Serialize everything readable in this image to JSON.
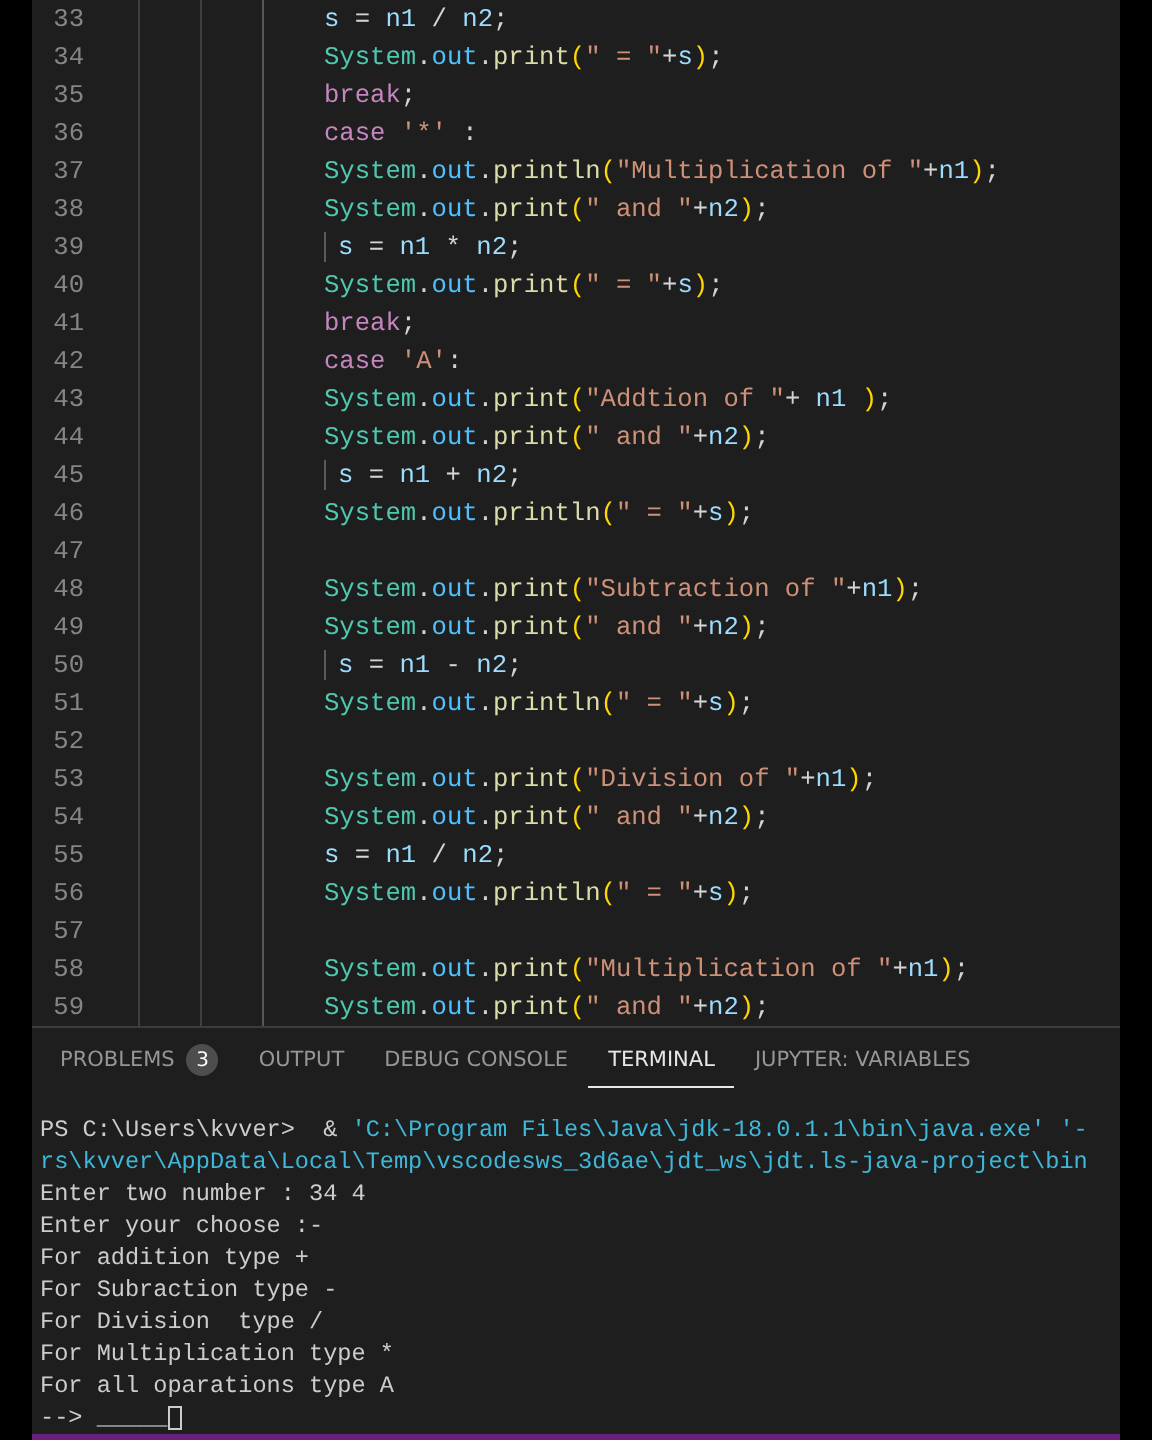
{
  "editor": {
    "lines": [
      {
        "number": "33",
        "tokens": [
          {
            "kind": "var",
            "text": "s"
          },
          {
            "kind": "op",
            "text": " = "
          },
          {
            "kind": "var",
            "text": "n1"
          },
          {
            "kind": "op",
            "text": " / "
          },
          {
            "kind": "var",
            "text": "n2"
          },
          {
            "kind": "op",
            "text": ";"
          }
        ]
      },
      {
        "number": "34",
        "tokens": [
          {
            "kind": "class",
            "text": "System"
          },
          {
            "kind": "op",
            "text": "."
          },
          {
            "kind": "field",
            "text": "out"
          },
          {
            "kind": "op",
            "text": "."
          },
          {
            "kind": "method",
            "text": "print"
          },
          {
            "kind": "paren",
            "text": "("
          },
          {
            "kind": "string",
            "text": "\" = \""
          },
          {
            "kind": "op",
            "text": "+"
          },
          {
            "kind": "var",
            "text": "s"
          },
          {
            "kind": "paren",
            "text": ")"
          },
          {
            "kind": "op",
            "text": ";"
          }
        ]
      },
      {
        "number": "35",
        "tokens": [
          {
            "kind": "keyword",
            "text": "break"
          },
          {
            "kind": "op",
            "text": ";"
          }
        ]
      },
      {
        "number": "36",
        "tokens": [
          {
            "kind": "keyword",
            "text": "case "
          },
          {
            "kind": "string",
            "text": "'*'"
          },
          {
            "kind": "op",
            "text": " :"
          }
        ]
      },
      {
        "number": "37",
        "tokens": [
          {
            "kind": "class",
            "text": "System"
          },
          {
            "kind": "op",
            "text": "."
          },
          {
            "kind": "field",
            "text": "out"
          },
          {
            "kind": "op",
            "text": "."
          },
          {
            "kind": "method",
            "text": "println"
          },
          {
            "kind": "paren",
            "text": "("
          },
          {
            "kind": "string",
            "text": "\"Multiplication of \""
          },
          {
            "kind": "op",
            "text": "+"
          },
          {
            "kind": "var",
            "text": "n1"
          },
          {
            "kind": "paren",
            "text": ")"
          },
          {
            "kind": "op",
            "text": ";"
          }
        ]
      },
      {
        "number": "38",
        "tokens": [
          {
            "kind": "class",
            "text": "System"
          },
          {
            "kind": "op",
            "text": "."
          },
          {
            "kind": "field",
            "text": "out"
          },
          {
            "kind": "op",
            "text": "."
          },
          {
            "kind": "method",
            "text": "print"
          },
          {
            "kind": "paren",
            "text": "("
          },
          {
            "kind": "string",
            "text": "\" and \""
          },
          {
            "kind": "op",
            "text": "+"
          },
          {
            "kind": "var",
            "text": "n2"
          },
          {
            "kind": "paren",
            "text": ")"
          },
          {
            "kind": "op",
            "text": ";"
          }
        ]
      },
      {
        "number": "39",
        "bar": true,
        "tokens": [
          {
            "kind": "var",
            "text": "s"
          },
          {
            "kind": "op",
            "text": " = "
          },
          {
            "kind": "var",
            "text": "n1"
          },
          {
            "kind": "op",
            "text": " * "
          },
          {
            "kind": "var",
            "text": "n2"
          },
          {
            "kind": "op",
            "text": ";"
          }
        ]
      },
      {
        "number": "40",
        "tokens": [
          {
            "kind": "class",
            "text": "System"
          },
          {
            "kind": "op",
            "text": "."
          },
          {
            "kind": "field",
            "text": "out"
          },
          {
            "kind": "op",
            "text": "."
          },
          {
            "kind": "method",
            "text": "print"
          },
          {
            "kind": "paren",
            "text": "("
          },
          {
            "kind": "string",
            "text": "\" = \""
          },
          {
            "kind": "op",
            "text": "+"
          },
          {
            "kind": "var",
            "text": "s"
          },
          {
            "kind": "paren",
            "text": ")"
          },
          {
            "kind": "op",
            "text": ";"
          }
        ]
      },
      {
        "number": "41",
        "tokens": [
          {
            "kind": "keyword",
            "text": "break"
          },
          {
            "kind": "op",
            "text": ";"
          }
        ]
      },
      {
        "number": "42",
        "tokens": [
          {
            "kind": "keyword",
            "text": "case "
          },
          {
            "kind": "string",
            "text": "'A'"
          },
          {
            "kind": "op",
            "text": ":"
          }
        ]
      },
      {
        "number": "43",
        "tokens": [
          {
            "kind": "class",
            "text": "System"
          },
          {
            "kind": "op",
            "text": "."
          },
          {
            "kind": "field",
            "text": "out"
          },
          {
            "kind": "op",
            "text": "."
          },
          {
            "kind": "method",
            "text": "print"
          },
          {
            "kind": "paren",
            "text": "("
          },
          {
            "kind": "string",
            "text": "\"Addtion of \""
          },
          {
            "kind": "op",
            "text": "+ "
          },
          {
            "kind": "var",
            "text": "n1 "
          },
          {
            "kind": "paren",
            "text": ")"
          },
          {
            "kind": "op",
            "text": ";"
          }
        ]
      },
      {
        "number": "44",
        "tokens": [
          {
            "kind": "class",
            "text": "System"
          },
          {
            "kind": "op",
            "text": "."
          },
          {
            "kind": "field",
            "text": "out"
          },
          {
            "kind": "op",
            "text": "."
          },
          {
            "kind": "method",
            "text": "print"
          },
          {
            "kind": "paren",
            "text": "("
          },
          {
            "kind": "string",
            "text": "\" and \""
          },
          {
            "kind": "op",
            "text": "+"
          },
          {
            "kind": "var",
            "text": "n2"
          },
          {
            "kind": "paren",
            "text": ")"
          },
          {
            "kind": "op",
            "text": ";"
          }
        ]
      },
      {
        "number": "45",
        "bar": true,
        "tokens": [
          {
            "kind": "var",
            "text": "s"
          },
          {
            "kind": "op",
            "text": " = "
          },
          {
            "kind": "var",
            "text": "n1"
          },
          {
            "kind": "op",
            "text": " + "
          },
          {
            "kind": "var",
            "text": "n2"
          },
          {
            "kind": "op",
            "text": ";"
          }
        ]
      },
      {
        "number": "46",
        "tokens": [
          {
            "kind": "class",
            "text": "System"
          },
          {
            "kind": "op",
            "text": "."
          },
          {
            "kind": "field",
            "text": "out"
          },
          {
            "kind": "op",
            "text": "."
          },
          {
            "kind": "method",
            "text": "println"
          },
          {
            "kind": "paren",
            "text": "("
          },
          {
            "kind": "string",
            "text": "\" = \""
          },
          {
            "kind": "op",
            "text": "+"
          },
          {
            "kind": "var",
            "text": "s"
          },
          {
            "kind": "paren",
            "text": ")"
          },
          {
            "kind": "op",
            "text": ";"
          }
        ]
      },
      {
        "number": "47"
      },
      {
        "number": "48",
        "tokens": [
          {
            "kind": "class",
            "text": "System"
          },
          {
            "kind": "op",
            "text": "."
          },
          {
            "kind": "field",
            "text": "out"
          },
          {
            "kind": "op",
            "text": "."
          },
          {
            "kind": "method",
            "text": "print"
          },
          {
            "kind": "paren",
            "text": "("
          },
          {
            "kind": "string",
            "text": "\"Subtraction of \""
          },
          {
            "kind": "op",
            "text": "+"
          },
          {
            "kind": "var",
            "text": "n1"
          },
          {
            "kind": "paren",
            "text": ")"
          },
          {
            "kind": "op",
            "text": ";"
          }
        ]
      },
      {
        "number": "49",
        "tokens": [
          {
            "kind": "class",
            "text": "System"
          },
          {
            "kind": "op",
            "text": "."
          },
          {
            "kind": "field",
            "text": "out"
          },
          {
            "kind": "op",
            "text": "."
          },
          {
            "kind": "method",
            "text": "print"
          },
          {
            "kind": "paren",
            "text": "("
          },
          {
            "kind": "string",
            "text": "\" and \""
          },
          {
            "kind": "op",
            "text": "+"
          },
          {
            "kind": "var",
            "text": "n2"
          },
          {
            "kind": "paren",
            "text": ")"
          },
          {
            "kind": "op",
            "text": ";"
          }
        ]
      },
      {
        "number": "50",
        "bar": true,
        "tokens": [
          {
            "kind": "var",
            "text": "s"
          },
          {
            "kind": "op",
            "text": " = "
          },
          {
            "kind": "var",
            "text": "n1"
          },
          {
            "kind": "op",
            "text": " - "
          },
          {
            "kind": "var",
            "text": "n2"
          },
          {
            "kind": "op",
            "text": ";"
          }
        ]
      },
      {
        "number": "51",
        "tokens": [
          {
            "kind": "class",
            "text": "System"
          },
          {
            "kind": "op",
            "text": "."
          },
          {
            "kind": "field",
            "text": "out"
          },
          {
            "kind": "op",
            "text": "."
          },
          {
            "kind": "method",
            "text": "println"
          },
          {
            "kind": "paren",
            "text": "("
          },
          {
            "kind": "string",
            "text": "\" = \""
          },
          {
            "kind": "op",
            "text": "+"
          },
          {
            "kind": "var",
            "text": "s"
          },
          {
            "kind": "paren",
            "text": ")"
          },
          {
            "kind": "op",
            "text": ";"
          }
        ]
      },
      {
        "number": "52"
      },
      {
        "number": "53",
        "tokens": [
          {
            "kind": "class",
            "text": "System"
          },
          {
            "kind": "op",
            "text": "."
          },
          {
            "kind": "field",
            "text": "out"
          },
          {
            "kind": "op",
            "text": "."
          },
          {
            "kind": "method",
            "text": "print"
          },
          {
            "kind": "paren",
            "text": "("
          },
          {
            "kind": "string",
            "text": "\"Division of \""
          },
          {
            "kind": "op",
            "text": "+"
          },
          {
            "kind": "var",
            "text": "n1"
          },
          {
            "kind": "paren",
            "text": ")"
          },
          {
            "kind": "op",
            "text": ";"
          }
        ]
      },
      {
        "number": "54",
        "tokens": [
          {
            "kind": "class",
            "text": "System"
          },
          {
            "kind": "op",
            "text": "."
          },
          {
            "kind": "field",
            "text": "out"
          },
          {
            "kind": "op",
            "text": "."
          },
          {
            "kind": "method",
            "text": "print"
          },
          {
            "kind": "paren",
            "text": "("
          },
          {
            "kind": "string",
            "text": "\" and \""
          },
          {
            "kind": "op",
            "text": "+"
          },
          {
            "kind": "var",
            "text": "n2"
          },
          {
            "kind": "paren",
            "text": ")"
          },
          {
            "kind": "op",
            "text": ";"
          }
        ]
      },
      {
        "number": "55",
        "tokens": [
          {
            "kind": "var",
            "text": "s"
          },
          {
            "kind": "op",
            "text": " = "
          },
          {
            "kind": "var",
            "text": "n1"
          },
          {
            "kind": "op",
            "text": " / "
          },
          {
            "kind": "var",
            "text": "n2"
          },
          {
            "kind": "op",
            "text": ";"
          }
        ]
      },
      {
        "number": "56",
        "tokens": [
          {
            "kind": "class",
            "text": "System"
          },
          {
            "kind": "op",
            "text": "."
          },
          {
            "kind": "field",
            "text": "out"
          },
          {
            "kind": "op",
            "text": "."
          },
          {
            "kind": "method",
            "text": "println"
          },
          {
            "kind": "paren",
            "text": "("
          },
          {
            "kind": "string",
            "text": "\" = \""
          },
          {
            "kind": "op",
            "text": "+"
          },
          {
            "kind": "var",
            "text": "s"
          },
          {
            "kind": "paren",
            "text": ")"
          },
          {
            "kind": "op",
            "text": ";"
          }
        ]
      },
      {
        "number": "57"
      },
      {
        "number": "58",
        "tokens": [
          {
            "kind": "class",
            "text": "System"
          },
          {
            "kind": "op",
            "text": "."
          },
          {
            "kind": "field",
            "text": "out"
          },
          {
            "kind": "op",
            "text": "."
          },
          {
            "kind": "method",
            "text": "print"
          },
          {
            "kind": "paren",
            "text": "("
          },
          {
            "kind": "string",
            "text": "\"Multiplication of \""
          },
          {
            "kind": "op",
            "text": "+"
          },
          {
            "kind": "var",
            "text": "n1"
          },
          {
            "kind": "paren",
            "text": ")"
          },
          {
            "kind": "op",
            "text": ";"
          }
        ]
      },
      {
        "number": "59",
        "tokens": [
          {
            "kind": "class",
            "text": "System"
          },
          {
            "kind": "op",
            "text": "."
          },
          {
            "kind": "field",
            "text": "out"
          },
          {
            "kind": "op",
            "text": "."
          },
          {
            "kind": "method",
            "text": "print"
          },
          {
            "kind": "paren",
            "text": "("
          },
          {
            "kind": "string",
            "text": "\" and \""
          },
          {
            "kind": "op",
            "text": "+"
          },
          {
            "kind": "var",
            "text": "n2"
          },
          {
            "kind": "paren",
            "text": ")"
          },
          {
            "kind": "op",
            "text": ";"
          }
        ]
      }
    ]
  },
  "panel": {
    "tabs": [
      {
        "label": "PROBLEMS",
        "badge": "3",
        "selected": false
      },
      {
        "label": "OUTPUT",
        "selected": false
      },
      {
        "label": "DEBUG CONSOLE",
        "selected": false
      },
      {
        "label": "TERMINAL",
        "selected": true
      },
      {
        "label": "JUPYTER: VARIABLES",
        "selected": false
      }
    ],
    "terminal": {
      "lines": [
        {
          "tokens": [
            {
              "kind": "plain",
              "text": "PS C:\\Users\\kvver>  & "
            },
            {
              "kind": "path",
              "text": "'C:\\Program Files\\Java\\jdk-18.0.1.1\\bin\\java.exe' '-"
            }
          ]
        },
        {
          "tokens": [
            {
              "kind": "path",
              "text": "rs\\kvver\\AppData\\Local\\Temp\\vscodesws_3d6ae\\jdt_ws\\jdt.ls-java-project\\bin"
            }
          ]
        },
        {
          "tokens": [
            {
              "kind": "plain",
              "text": "Enter two number : 34 4"
            }
          ]
        },
        {
          "tokens": [
            {
              "kind": "plain",
              "text": "Enter your choose :-"
            }
          ]
        },
        {
          "tokens": [
            {
              "kind": "plain",
              "text": "For addition type +"
            }
          ]
        },
        {
          "tokens": [
            {
              "kind": "plain",
              "text": "For Subraction type -"
            }
          ]
        },
        {
          "tokens": [
            {
              "kind": "plain",
              "text": "For Division  type /"
            }
          ]
        },
        {
          "tokens": [
            {
              "kind": "plain",
              "text": "For Multiplication type *"
            }
          ]
        },
        {
          "tokens": [
            {
              "kind": "plain",
              "text": "For all oparations type A"
            }
          ]
        }
      ],
      "prompt": "--> _____"
    }
  }
}
